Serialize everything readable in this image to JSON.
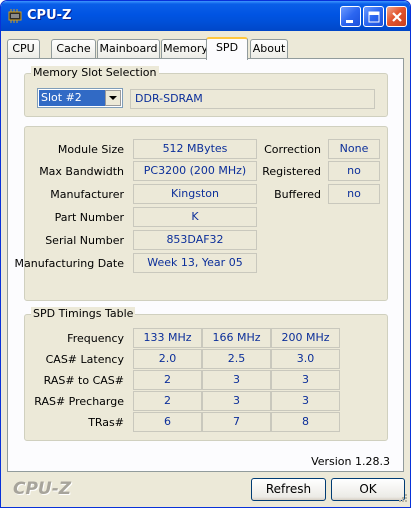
{
  "window": {
    "title": "CPU-Z",
    "title_bar_color": "#0054e3"
  },
  "tabs": [
    {
      "label": "CPU"
    },
    {
      "label": "Cache"
    },
    {
      "label": "Mainboard"
    },
    {
      "label": "Memory"
    },
    {
      "label": "SPD"
    },
    {
      "label": "About"
    }
  ],
  "active_tab": "SPD",
  "slot_selection": {
    "group_title": "Memory Slot Selection",
    "selected_slot": "Slot #2",
    "memory_type": "DDR-SDRAM"
  },
  "module": {
    "module_size_label": "Module Size",
    "module_size": "512 MBytes",
    "max_bandwidth_label": "Max Bandwidth",
    "max_bandwidth": "PC3200 (200 MHz)",
    "manufacturer_label": "Manufacturer",
    "manufacturer": "Kingston",
    "part_number_label": "Part Number",
    "part_number": "K",
    "serial_number_label": "Serial Number",
    "serial_number": "853DAF32",
    "manufacturing_date_label": "Manufacturing Date",
    "manufacturing_date": "Week 13, Year 05",
    "correction_label": "Correction",
    "correction": "None",
    "registered_label": "Registered",
    "registered": "no",
    "buffered_label": "Buffered",
    "buffered": "no"
  },
  "timings": {
    "group_title": "SPD Timings Table",
    "rows": [
      {
        "label": "Frequency",
        "values": [
          "133 MHz",
          "166 MHz",
          "200 MHz"
        ]
      },
      {
        "label": "CAS# Latency",
        "values": [
          "2.0",
          "2.5",
          "3.0"
        ]
      },
      {
        "label": "RAS# to CAS#",
        "values": [
          "2",
          "3",
          "3"
        ]
      },
      {
        "label": "RAS# Precharge",
        "values": [
          "2",
          "3",
          "3"
        ]
      },
      {
        "label": "TRas#",
        "values": [
          "6",
          "7",
          "8"
        ]
      }
    ]
  },
  "footer": {
    "version": "Version 1.28.3",
    "watermark": "CPU-Z",
    "refresh_label": "Refresh",
    "ok_label": "OK"
  },
  "colors": {
    "value_text": "#0c2f9a",
    "dialog_bg": "#ece9d8",
    "active_tab_highlight": "#ffc73c"
  }
}
